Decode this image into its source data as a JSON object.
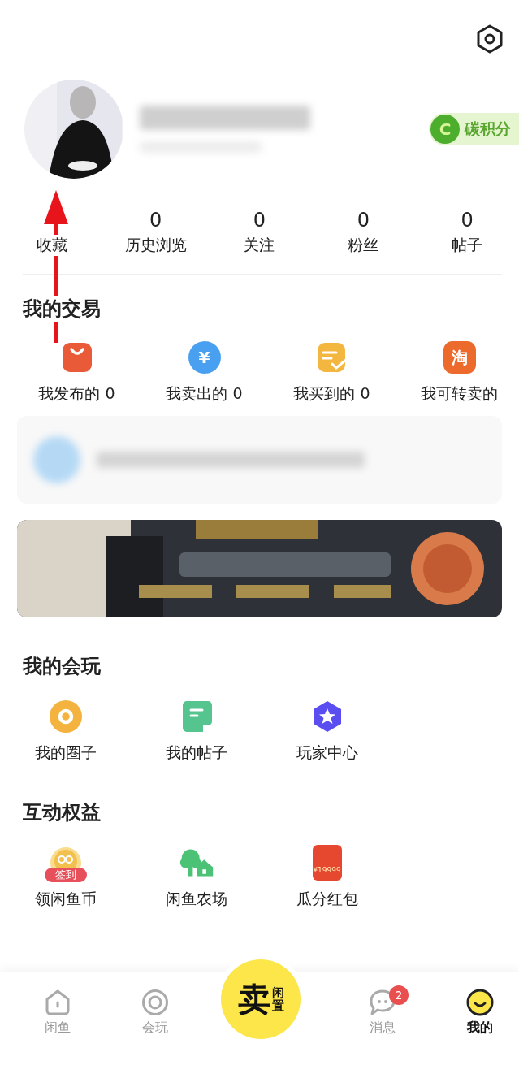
{
  "header": {
    "carbon_badge": {
      "icon_letter": "C",
      "label": "碳积分"
    }
  },
  "stats": [
    {
      "label": "收藏"
    },
    {
      "value": "0",
      "label": "历史浏览"
    },
    {
      "value": "0",
      "label": "关注"
    },
    {
      "value": "0",
      "label": "粉丝"
    },
    {
      "value": "0",
      "label": "帖子"
    }
  ],
  "trade": {
    "title": "我的交易",
    "items": [
      {
        "kind": "bag",
        "label": "我发布的 0"
      },
      {
        "kind": "coin",
        "glyph": "¥",
        "label": "我卖出的 0"
      },
      {
        "kind": "note",
        "label": "我买到的 0"
      },
      {
        "kind": "tao",
        "glyph": "淘",
        "label": "我可转卖的"
      }
    ]
  },
  "play": {
    "title": "我的会玩",
    "items": [
      {
        "kind": "ring",
        "label": "我的圈子"
      },
      {
        "kind": "post",
        "label": "我的帖子"
      },
      {
        "kind": "star",
        "label": "玩家中心"
      }
    ]
  },
  "benefits": {
    "title": "互动权益",
    "items": [
      {
        "kind": "signin",
        "tag": "签到",
        "label": "领闲鱼币"
      },
      {
        "kind": "farm",
        "label": "闲鱼农场"
      },
      {
        "kind": "redpacket",
        "amount": "¥19999",
        "label": "瓜分红包"
      }
    ]
  },
  "nav": {
    "items": [
      {
        "kind": "home",
        "label": "闲鱼",
        "selected": false
      },
      {
        "kind": "play",
        "label": "会玩",
        "selected": false
      },
      {
        "kind": "sell",
        "label": "卖",
        "sub": "闲置"
      },
      {
        "kind": "messages",
        "label": "消息",
        "badge": "2",
        "selected": false
      },
      {
        "kind": "me",
        "label": "我的",
        "selected": true
      }
    ]
  }
}
